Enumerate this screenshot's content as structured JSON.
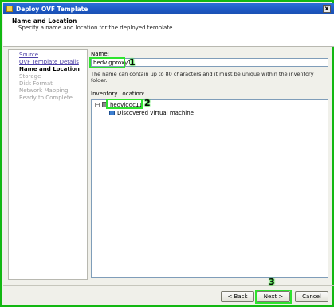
{
  "window": {
    "title": "Deploy OVF Template",
    "close_glyph": "x"
  },
  "header": {
    "title": "Name and Location",
    "subtitle": "Specify a name and location for the deployed template"
  },
  "steps": [
    {
      "label": "Source",
      "state": "link"
    },
    {
      "label": "OVF Template Details",
      "state": "link"
    },
    {
      "label": "Name and Location",
      "state": "current"
    },
    {
      "label": "Storage",
      "state": "future"
    },
    {
      "label": "Disk Format",
      "state": "future"
    },
    {
      "label": "Network Mapping",
      "state": "future"
    },
    {
      "label": "Ready to Complete",
      "state": "future"
    }
  ],
  "form": {
    "name_label": "Name:",
    "name_value": "hedvigproxy1",
    "name_hint": "The name can contain up to 80 characters and it must be unique within the inventory folder.",
    "inventory_label": "Inventory Location:",
    "tree": {
      "expander": "−",
      "root": "hedvigdc11",
      "child": "Discovered virtual machine"
    }
  },
  "annotations": {
    "n1": "1",
    "n2": "2",
    "n3": "3",
    "color": "#2ee32e"
  },
  "buttons": {
    "back": "< Back",
    "next": "Next >",
    "cancel": "Cancel"
  }
}
